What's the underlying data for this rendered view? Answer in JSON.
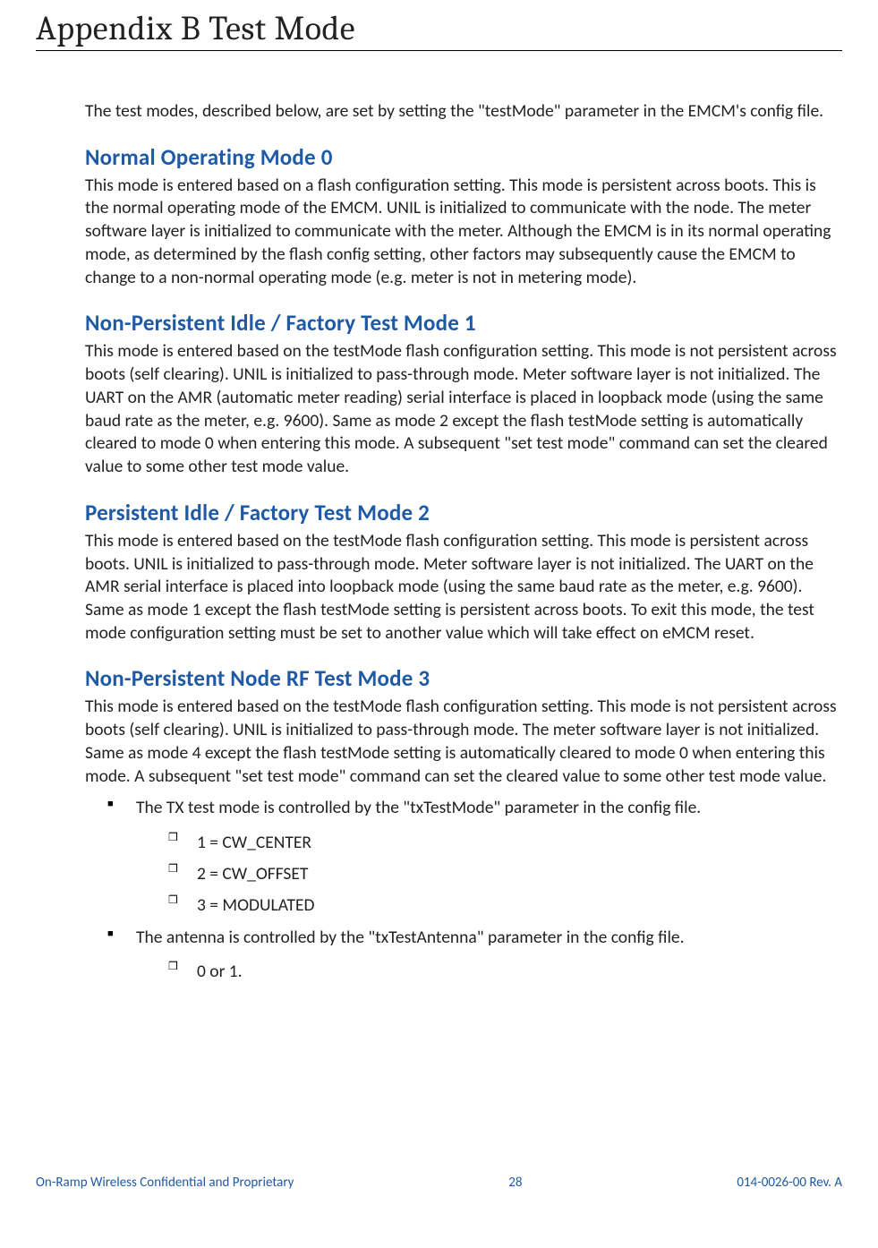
{
  "title_prefix": "Appendix B",
  "title_main": "Test Mode",
  "intro": "The test modes, described below, are set by setting the \"testMode\" parameter in the EMCM's config file.",
  "sections": [
    {
      "heading": "Normal Operating Mode 0",
      "body": "This mode is entered based on a flash configuration setting. This mode is persistent across boots. This is the normal operating mode of the EMCM. UNIL is initialized to communicate with the node. The meter software layer is initialized to communicate with the meter. Although the EMCM is in its normal operating mode, as determined by the flash config setting, other factors may subsequently cause the EMCM to change to a non-normal operating mode (e.g. meter is not in metering mode)."
    },
    {
      "heading": "Non-Persistent Idle / Factory Test Mode 1",
      "body": "This mode is entered based on the testMode flash configuration setting. This mode is not persistent across boots (self clearing). UNIL is initialized to pass-through mode. Meter software layer is not initialized. The UART on the AMR (automatic meter reading) serial interface is placed in loopback mode (using the same baud rate as the meter, e.g. 9600). Same as mode 2 except the flash testMode setting is automatically cleared to mode 0 when entering this mode. A subsequent \"set test mode\" command can set the cleared value to some other test mode value."
    },
    {
      "heading": "Persistent Idle / Factory Test Mode 2",
      "body": "This mode is entered based on the testMode flash configuration setting. This mode is persistent across boots. UNIL is initialized to pass-through mode. Meter software layer is not initialized. The UART on the AMR serial interface is placed into loopback mode (using the same baud rate as the meter, e.g. 9600). Same as mode 1 except the flash testMode setting is persistent across boots. To exit this mode, the test mode configuration setting must be set to another value which will take effect on eMCM reset."
    },
    {
      "heading": "Non-Persistent Node RF Test Mode 3",
      "body": "This mode is entered based on the testMode flash configuration setting. This mode is not persistent across boots (self clearing). UNIL is initialized to pass-through mode. The meter software layer is not initialized. Same as mode 4 except the flash testMode setting is automatically cleared to mode 0 when entering this mode. A subsequent \"set test mode\" command can set the cleared value to some other test mode value."
    }
  ],
  "bullets": {
    "item1": "The TX test mode is controlled by the \"txTestMode\" parameter in the config file.",
    "sub1a": "1 = CW_CENTER",
    "sub1b": "2 = CW_OFFSET",
    "sub1c": "3 = MODULATED",
    "item2": "The antenna is controlled by the \"txTestAntenna\" parameter in the config file.",
    "sub2a": "0 or 1."
  },
  "footer": {
    "left": "On-Ramp Wireless Confidential and Proprietary",
    "center": "28",
    "right": "014-0026-00 Rev. A"
  }
}
